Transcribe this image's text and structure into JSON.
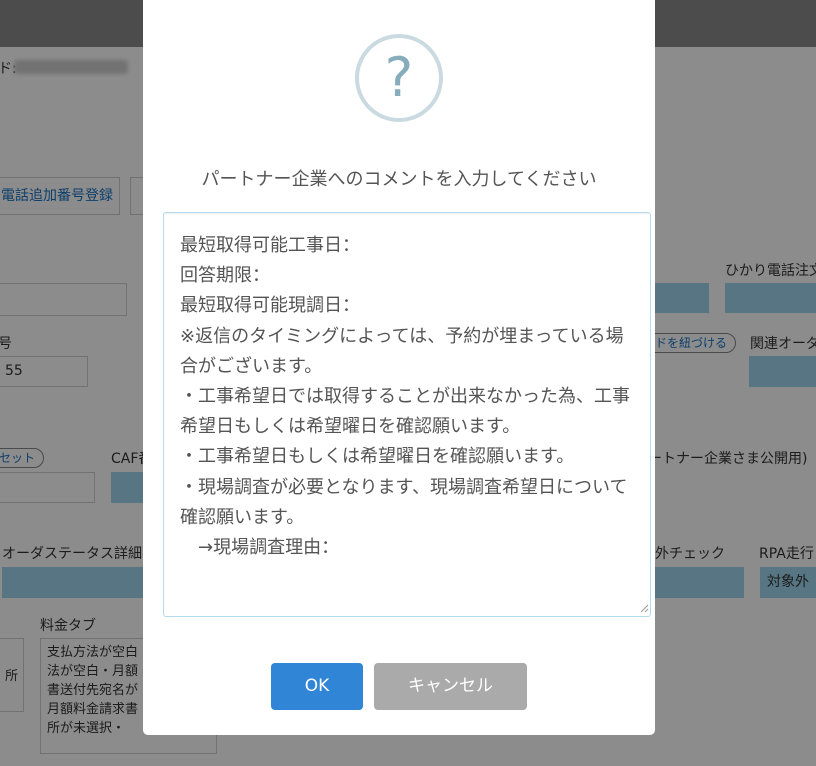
{
  "background": {
    "header_label": "ド:",
    "phone_add_button": "電話追加番号登録",
    "hikari_order_label": "ひかり電話注文",
    "number_label": "号",
    "number_value": "55",
    "link_button": "ドを紐づける",
    "related_order_label": "関連オーダ",
    "reset_button": "セット",
    "caf_label": "CAF番",
    "partner_public_label": "ートナー企業さま公開用)",
    "order_status_label": "オーダステータス詳細",
    "exclude_check_label": "外チェック",
    "rpa_label": "RPA走行",
    "rpa_value": "対象外",
    "fee_tab_label": "料金タブ",
    "fee_tab_text": "支払方法が空白\n法が空白・月額\n書送付先宛名が\n月額料金請求書\n所が未選択・",
    "left_field_text": "所"
  },
  "dialog": {
    "icon": "question-icon",
    "icon_glyph": "?",
    "title": "パートナー企業へのコメントを入力してください",
    "comment_value": "最短取得可能工事日：\n回答期限：\n最短取得可能現調日：\n※返信のタイミングによっては、予約が埋まっている場合がございます。\n・工事希望日では取得することが出来なかった為、工事希望日もしくは希望曜日を確認願います。\n・工事希望日もしくは希望曜日を確認願います。\n・現場調査が必要となります、現場調査希望日について確認願います。\n　→現場調査理由：",
    "ok_label": "OK",
    "cancel_label": "キャンセル"
  },
  "colors": {
    "ok_button": "#3085d6",
    "cancel_button": "#aaaaaa",
    "icon_ring": "#c9dae1",
    "icon_glyph": "#87adbd",
    "field_highlight": "#9fd6ef"
  }
}
